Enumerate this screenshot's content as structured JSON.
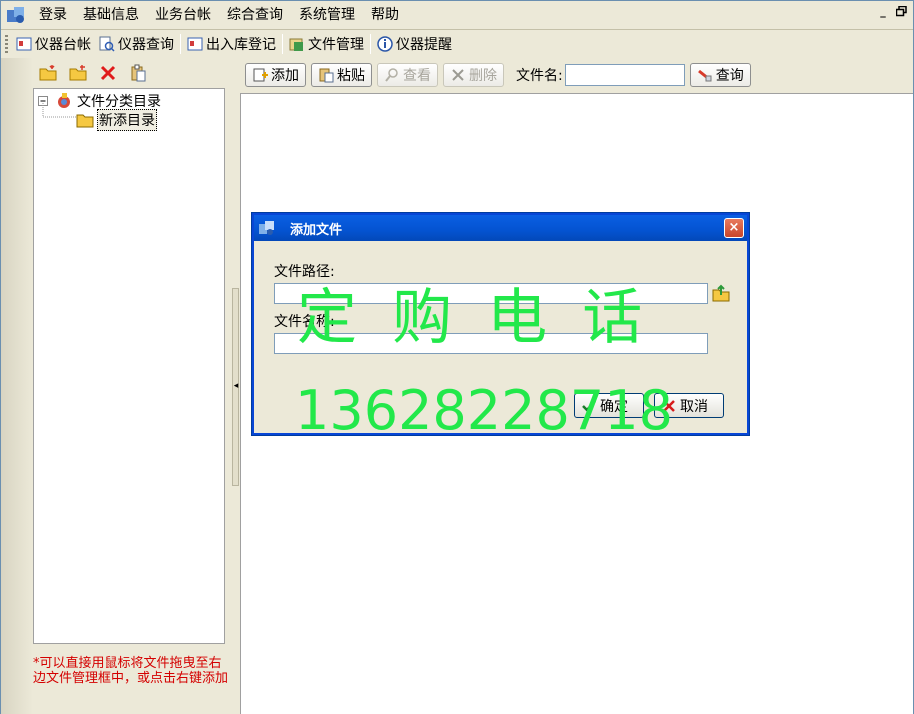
{
  "menu": [
    "登录",
    "基础信息",
    "业务台帐",
    "综合查询",
    "系统管理",
    "帮助"
  ],
  "window_controls": {
    "minimize": "_",
    "restore": "▫"
  },
  "toolbar": [
    {
      "label": "仪器台帐",
      "icon": "ledger-icon"
    },
    {
      "label": "仪器查询",
      "icon": "query-icon"
    },
    {
      "label": "出入库登记",
      "icon": "stock-icon"
    },
    {
      "label": "文件管理",
      "icon": "file-manage-icon"
    },
    {
      "label": "仪器提醒",
      "icon": "info-icon"
    }
  ],
  "tree": {
    "root": "文件分类目录",
    "child": "新添目录"
  },
  "hint": "*可以直接用鼠标将文件拖曳至右边文件管理框中，或点击右键添加",
  "file_toolbar": {
    "add": "添加",
    "paste": "粘贴",
    "view": "查看",
    "delete": "删除",
    "filename_label": "文件名:",
    "filename_value": "",
    "search": "查询"
  },
  "dialog": {
    "title": "添加文件",
    "path_label": "文件路径:",
    "path_value": "",
    "name_label": "文件名称:",
    "name_value": "",
    "ok": "确定",
    "cancel": "取消",
    "close": "×"
  },
  "watermark": {
    "line1": "定 购 电 话",
    "line2": "13628228718"
  },
  "colors": {
    "title_bar": "#0453d1",
    "hint_text": "#d40000",
    "watermark": "#22e84a"
  }
}
